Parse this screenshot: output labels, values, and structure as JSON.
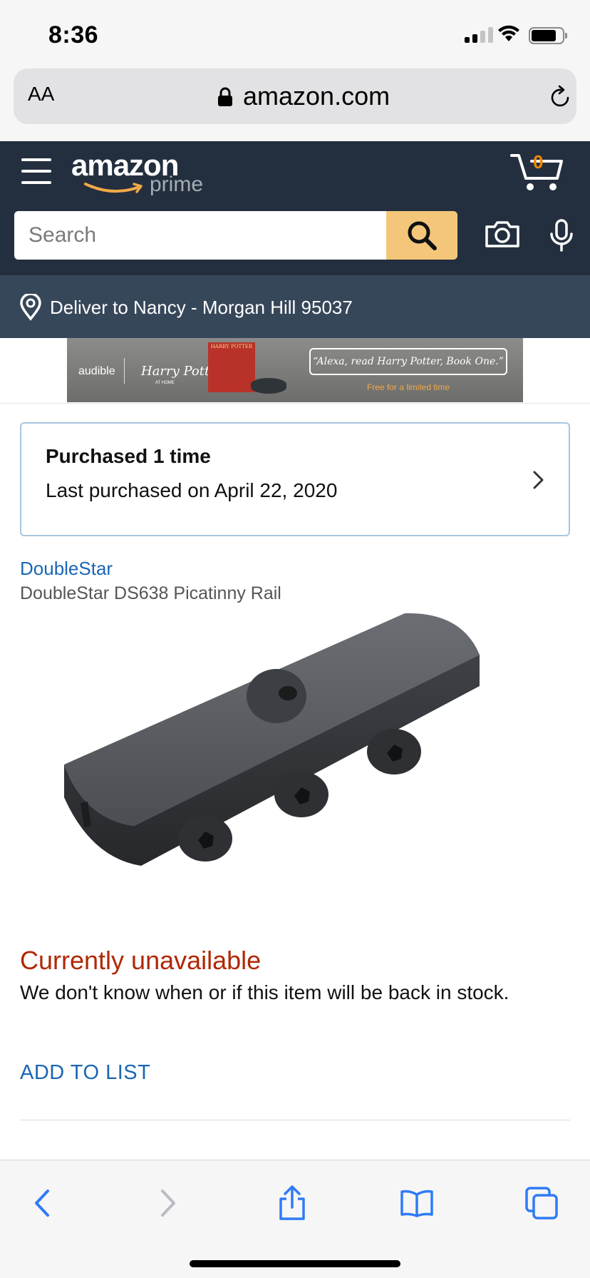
{
  "status_bar": {
    "time": "8:36"
  },
  "browser": {
    "text_size_label": "AA",
    "domain": "amazon.com"
  },
  "header": {
    "logo_text": "amazon",
    "logo_sub": "prime",
    "cart_count": "0",
    "search_placeholder": "Search"
  },
  "deliver": {
    "text": "Deliver to Nancy - Morgan Hill 95037"
  },
  "banner": {
    "audible": "audible",
    "harry_potter": "Harry Potter",
    "at_home": "AT HOME",
    "book_title": "HARRY POTTER",
    "quote": "“Alexa, read Harry Potter, Book One.”",
    "free": "Free for a limited time"
  },
  "purchase_history": {
    "title": "Purchased 1 time",
    "last": "Last purchased on April 22, 2020"
  },
  "product": {
    "brand": "DoubleStar",
    "title": "DoubleStar DS638 Picatinny Rail",
    "availability": "Currently unavailable",
    "availability_detail": "We don't know when or if this item will be back in stock.",
    "add_to_list": "ADD TO LIST"
  },
  "colors": {
    "amazon_navy": "#232f3e",
    "deliver_bar": "#37475a",
    "search_button": "#f3c67a",
    "link_blue": "#1a66b3",
    "unavailable_red": "#b12704",
    "cart_orange": "#f08804"
  }
}
